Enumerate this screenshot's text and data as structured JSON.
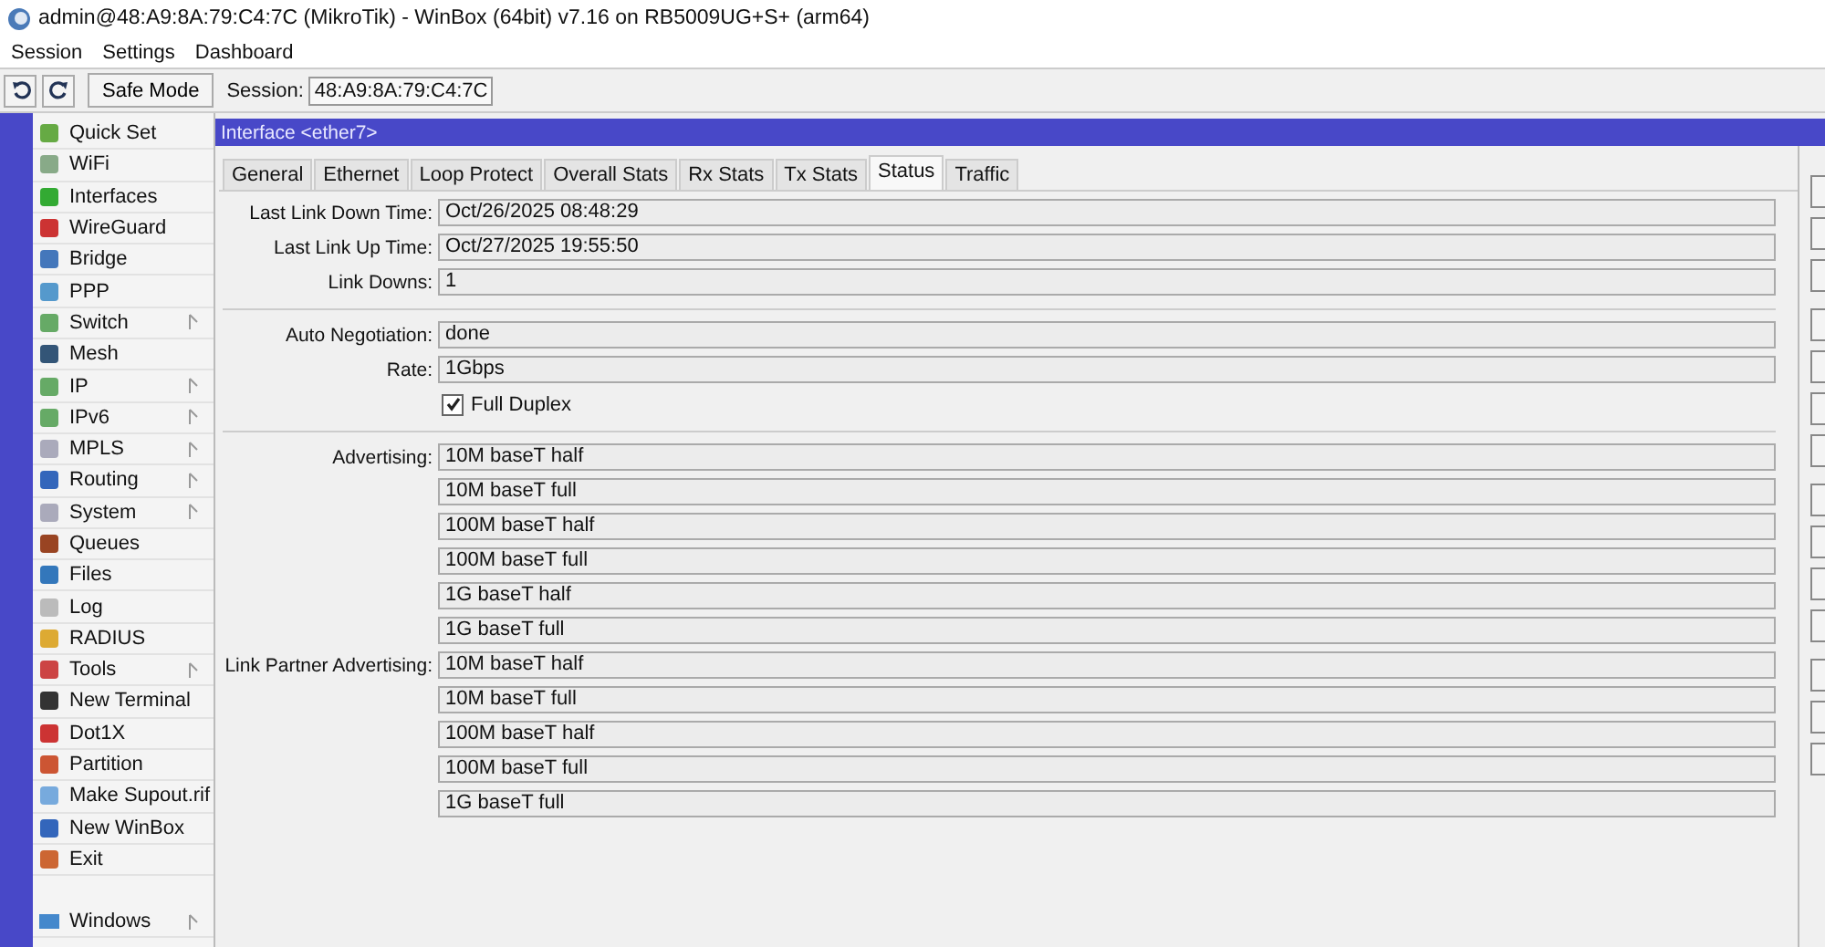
{
  "window": {
    "title": "admin@48:A9:8A:79:C4:7C (MikroTik) - WinBox (64bit) v7.16 on RB5009UG+S+ (arm64)"
  },
  "menu": [
    "Session",
    "Settings",
    "Dashboard"
  ],
  "toolbar": {
    "safe_mode": "Safe Mode",
    "session_label": "Session:",
    "session_value": "48:A9:8A:79:C4:7C"
  },
  "sidebar": {
    "items": [
      {
        "label": "Quick Set",
        "submenu": false
      },
      {
        "label": "WiFi",
        "submenu": false
      },
      {
        "label": "Interfaces",
        "submenu": false
      },
      {
        "label": "WireGuard",
        "submenu": false
      },
      {
        "label": "Bridge",
        "submenu": false
      },
      {
        "label": "PPP",
        "submenu": false
      },
      {
        "label": "Switch",
        "submenu": true
      },
      {
        "label": "Mesh",
        "submenu": false
      },
      {
        "label": "IP",
        "submenu": true
      },
      {
        "label": "IPv6",
        "submenu": true
      },
      {
        "label": "MPLS",
        "submenu": true
      },
      {
        "label": "Routing",
        "submenu": true
      },
      {
        "label": "System",
        "submenu": true
      },
      {
        "label": "Queues",
        "submenu": false
      },
      {
        "label": "Files",
        "submenu": false
      },
      {
        "label": "Log",
        "submenu": false
      },
      {
        "label": "RADIUS",
        "submenu": false
      },
      {
        "label": "Tools",
        "submenu": true
      },
      {
        "label": "New Terminal",
        "submenu": false
      },
      {
        "label": "Dot1X",
        "submenu": false
      },
      {
        "label": "Partition",
        "submenu": false
      },
      {
        "label": "Make Supout.rif",
        "submenu": false
      },
      {
        "label": "New WinBox",
        "submenu": false
      },
      {
        "label": "Exit",
        "submenu": false
      }
    ],
    "bottom_item": {
      "label": "Windows",
      "submenu": true
    }
  },
  "dialog": {
    "title": "Interface <ether7>",
    "tabs": [
      {
        "label": "General",
        "selected": false
      },
      {
        "label": "Ethernet",
        "selected": false
      },
      {
        "label": "Loop Protect",
        "selected": false
      },
      {
        "label": "Overall Stats",
        "selected": false
      },
      {
        "label": "Rx Stats",
        "selected": false
      },
      {
        "label": "Tx Stats",
        "selected": false
      },
      {
        "label": "Status",
        "selected": true
      },
      {
        "label": "Traffic",
        "selected": false
      }
    ],
    "section_1": [
      {
        "label": "Last Link Down Time:",
        "value": "Oct/26/2025 08:48:29"
      },
      {
        "label": "Last Link Up Time:",
        "value": "Oct/27/2025 19:55:50"
      },
      {
        "label": "Link Downs:",
        "value": "1"
      }
    ],
    "section_2": [
      {
        "label": "Auto Negotiation:",
        "value": "done"
      },
      {
        "label": "Rate:",
        "value": "1Gbps"
      }
    ],
    "full_duplex": {
      "label": "Full Duplex",
      "checked": true
    },
    "lists": [
      {
        "label": "Advertising:",
        "values": [
          "10M baseT half",
          "10M baseT full",
          "100M baseT half",
          "100M baseT full",
          "1G baseT half",
          "1G baseT full"
        ]
      },
      {
        "label": "Link Partner Advertising:",
        "values": [
          "10M baseT half",
          "10M baseT full",
          "100M baseT half",
          "100M baseT full",
          "1G baseT full"
        ]
      }
    ]
  }
}
